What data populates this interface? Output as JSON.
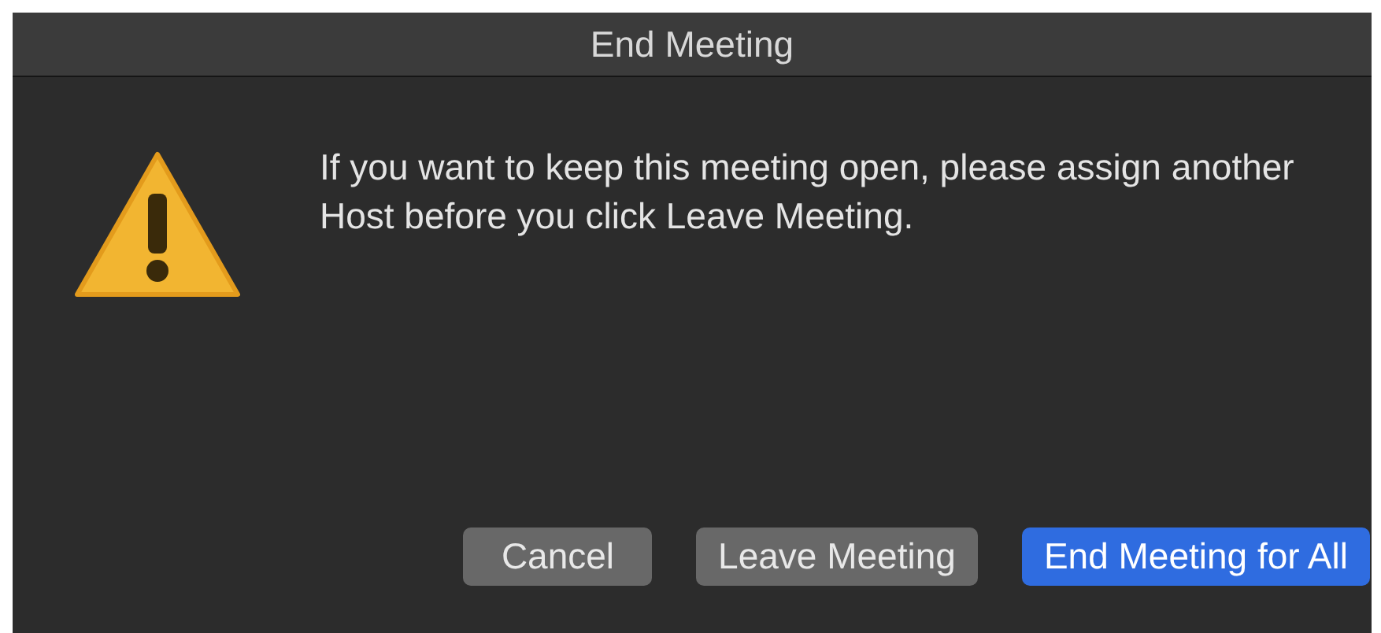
{
  "window": {
    "title": "End Meeting"
  },
  "message": "If you want to keep this meeting open, please assign another Host before you click Leave Meeting.",
  "buttons": [
    {
      "label": "Cancel",
      "kind": "normal"
    },
    {
      "label": "Leave Meeting",
      "kind": "normal"
    },
    {
      "label": "End Meeting for All",
      "kind": "default"
    }
  ]
}
